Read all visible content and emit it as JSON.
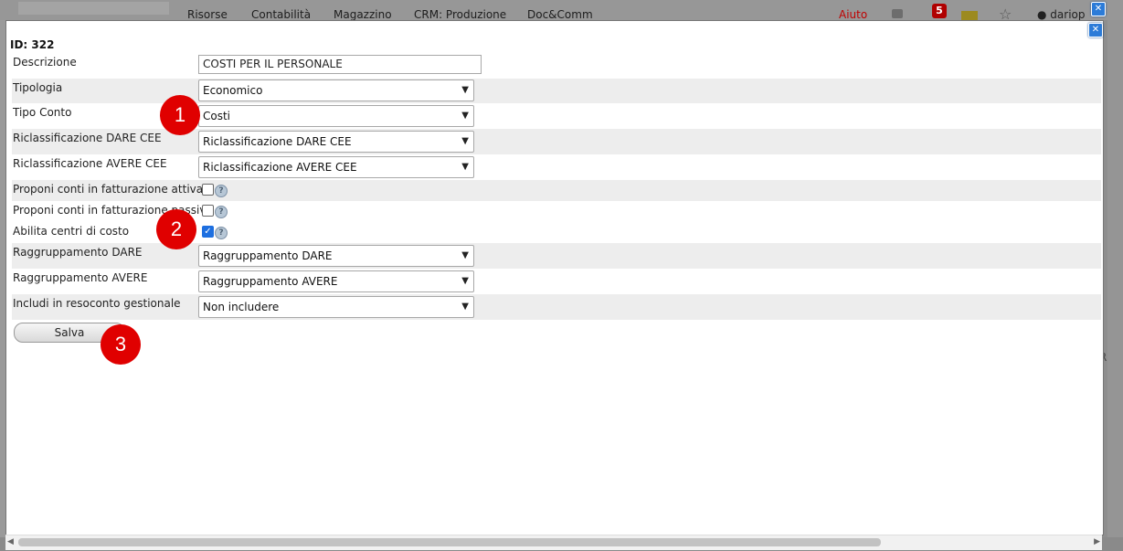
{
  "topnav": {
    "items": [
      "Risorse",
      "Contabilità",
      "Magazzino",
      "CRM: Produzione",
      "Doc&Comm"
    ],
    "help": "Aiuto",
    "notification_count": "5",
    "user": "dariop"
  },
  "dialog": {
    "id_label": "ID: 322",
    "fields": {
      "descrizione": {
        "label": "Descrizione",
        "value": "COSTI PER IL PERSONALE"
      },
      "tipologia": {
        "label": "Tipologia",
        "value": "Economico"
      },
      "tipo_conto": {
        "label": "Tipo Conto",
        "value": "Costi"
      },
      "ricl_dare": {
        "label": "Riclassificazione DARE CEE",
        "value": "Riclassificazione DARE CEE"
      },
      "ricl_avere": {
        "label": "Riclassificazione AVERE CEE",
        "value": "Riclassificazione AVERE CEE"
      },
      "proponi_attiva": {
        "label": "Proponi conti in fatturazione attiva",
        "checked": false
      },
      "proponi_passiva": {
        "label": "Proponi conti in fatturazione passiva",
        "checked": false
      },
      "centri_costo": {
        "label": "Abilita centri di costo",
        "checked": true
      },
      "raggr_dare": {
        "label": "Raggruppamento DARE",
        "value": "Raggruppamento DARE"
      },
      "raggr_avere": {
        "label": "Raggruppamento AVERE",
        "value": "Raggruppamento AVERE"
      },
      "resoconto": {
        "label": "Includi in resoconto gestionale",
        "value": "Non includere"
      }
    },
    "save_label": "Salva"
  },
  "markers": [
    "1",
    "2",
    "3"
  ],
  "icons": {
    "chevron": "chevron-down-icon",
    "help": "question-circle-icon",
    "close": "close-icon"
  },
  "colors": {
    "marker": "#e00000",
    "close_button": "#2b7bd8",
    "shaded_row": "#ededed"
  }
}
